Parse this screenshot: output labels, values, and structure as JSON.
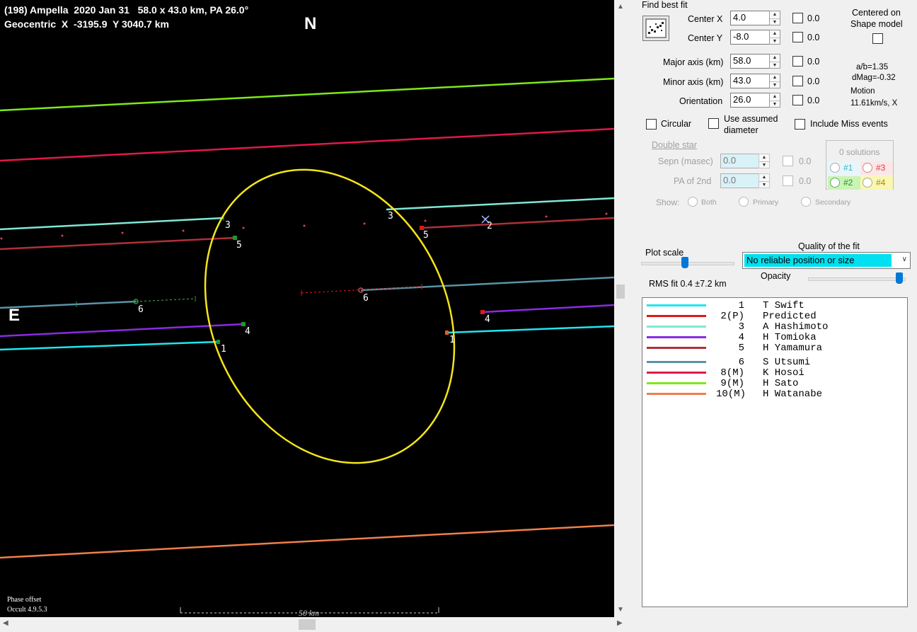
{
  "plot": {
    "header_line1": "(198) Ampella  2020 Jan 31   58.0 x 43.0 km, PA 26.0°",
    "header_line2": "Geocentric  X  -3195.9  Y 3040.7 km",
    "north": "N",
    "east": "E",
    "phase_offset": "Phase offset",
    "version": "Occult 4.9.5.3",
    "scale_label": "50 km",
    "chord_labels": {
      "c1a": "1",
      "c1b": "1",
      "c2": "2",
      "c3a": "3",
      "c3b": "3",
      "c4a": "4",
      "c4b": "4",
      "c5a": "5",
      "c5b": "5",
      "c6a": "6",
      "c6b": "6"
    },
    "colors": {
      "ellipse": "#f5e51a",
      "swift": "#1fe6f0",
      "predicted": "#e01818",
      "hashimoto": "#7fe8d6",
      "tomioka": "#8a2be2",
      "yamamura": "#b03038",
      "utsumi": "#5a93a6",
      "hosoi": "#e0194a",
      "sato": "#7ee81b",
      "watanabe": "#f07f4a"
    }
  },
  "panel": {
    "find_best_fit": "Find best fit",
    "center_x_label": "Center X",
    "center_x_value": "4.0",
    "center_y_label": "Center Y",
    "center_y_value": "-8.0",
    "major_label": "Major axis (km)",
    "major_value": "58.0",
    "minor_label": "Minor axis (km)",
    "minor_value": "43.0",
    "orient_label": "Orientation",
    "orient_value": "26.0",
    "zero_label": "0.0",
    "centered_on": "Centered on",
    "shape_model": "Shape model",
    "ab_ratio": "a/b=1.35",
    "dmag": "dMag=-0.32",
    "motion_label": "Motion",
    "motion_value": "11.61km/s, X",
    "circular": "Circular",
    "use_assumed_1": "Use assumed",
    "use_assumed_2": "diameter",
    "include_miss": "Include Miss events",
    "double_star": "Double star",
    "sepn_label": "Sepn (masec)",
    "sepn_value": "0.0",
    "pa2_label": "PA of 2nd",
    "pa2_value": "0.0",
    "show_label": "Show:",
    "show_both": "Both",
    "show_primary": "Primary",
    "show_secondary": "Secondary",
    "solutions_title": "0 solutions",
    "sol1": "#1",
    "sol2": "#2",
    "sol3": "#3",
    "sol4": "#4",
    "plot_scale": "Plot scale",
    "quality_label": "Quality of the fit",
    "quality_value": "No reliable position or size",
    "opacity": "Opacity",
    "rms": "RMS fit  0.4 ±7.2 km"
  },
  "legend": [
    {
      "num": "1",
      "name": "T Swift",
      "color": "#1fe6f0"
    },
    {
      "num": "2(P)",
      "name": "Predicted",
      "color": "#e01818"
    },
    {
      "num": "3",
      "name": "A Hashimoto",
      "color": "#7fe8d6"
    },
    {
      "num": "4",
      "name": "H Tomioka",
      "color": "#8a2be2"
    },
    {
      "num": "5",
      "name": "H Yamamura",
      "color": "#b03038"
    },
    {
      "num": "6",
      "name": "S Utsumi",
      "color": "#5a93a6"
    },
    {
      "num": "8(M)",
      "name": "K Hosoi",
      "color": "#e0194a"
    },
    {
      "num": "9(M)",
      "name": "H Sato",
      "color": "#7ee81b"
    },
    {
      "num": "10(M)",
      "name": "H Watanabe",
      "color": "#f07f4a"
    }
  ]
}
